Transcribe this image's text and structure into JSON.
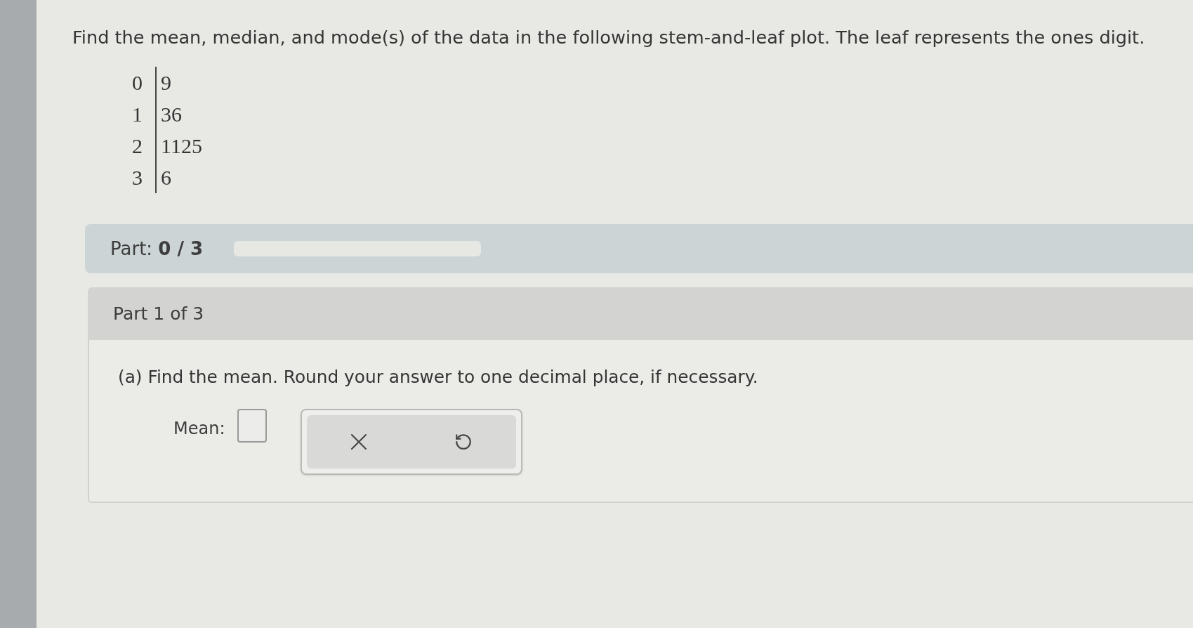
{
  "question": {
    "text": "Find the mean, median, and mode(s) of the data in the following stem-and-leaf plot. The leaf represents the ones digit."
  },
  "stem_leaf_plot": {
    "rows": [
      {
        "stem": "0",
        "leaves": "9"
      },
      {
        "stem": "1",
        "leaves": "36"
      },
      {
        "stem": "2",
        "leaves": "1125"
      },
      {
        "stem": "3",
        "leaves": "6"
      }
    ]
  },
  "progress": {
    "label": "Part: **0 / 3**"
  },
  "part": {
    "title": "Part 1 of 3",
    "prompt": "(a) Find the mean. Round your answer to one decimal place, if necessary.",
    "answer": {
      "label": "Mean:"
    }
  }
}
